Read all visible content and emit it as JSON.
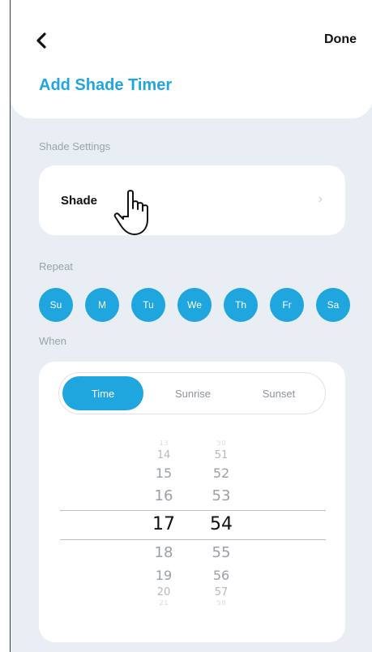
{
  "header": {
    "done_label": "Done",
    "title": "Add Shade Timer"
  },
  "shade_settings": {
    "section_label": "Shade Settings",
    "shade_label": "Shade"
  },
  "repeat": {
    "section_label": "Repeat",
    "days": [
      "Su",
      "M",
      "Tu",
      "We",
      "Th",
      "Fr",
      "Sa"
    ]
  },
  "when": {
    "section_label": "When",
    "tabs": [
      "Time",
      "Sunrise",
      "Sunset"
    ],
    "selected_tab": "Time",
    "picker": {
      "hours": [
        "13",
        "14",
        "15",
        "16",
        "17",
        "18",
        "19",
        "20",
        "21"
      ],
      "minutes": [
        "50",
        "51",
        "52",
        "53",
        "54",
        "55",
        "56",
        "57",
        "58"
      ],
      "selected_hour": "17",
      "selected_minute": "54"
    }
  },
  "colors": {
    "accent": "#1fa6de",
    "background": "#e9eef4",
    "card": "#ffffff"
  },
  "icons": [
    "chevron-left-icon",
    "chevron-right-icon",
    "pointer-hand-icon"
  ]
}
